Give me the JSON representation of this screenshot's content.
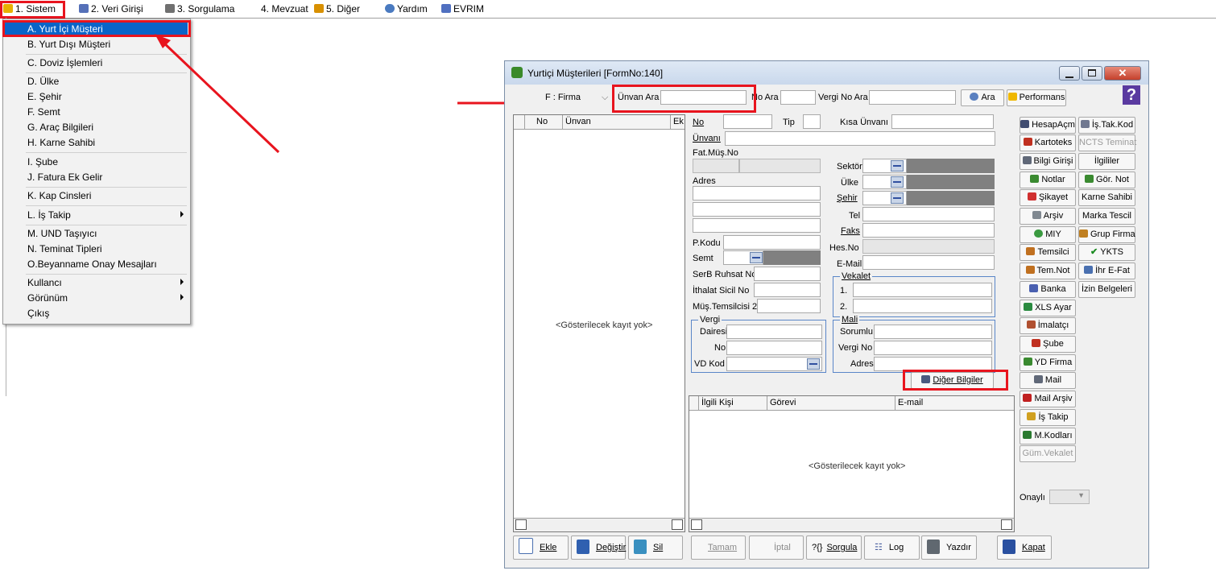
{
  "menubar": {
    "items": [
      {
        "label": "1. Sistem",
        "icon": "sistem-icon",
        "color": "#e8b000"
      },
      {
        "label": "2. Veri Girişi",
        "icon": "edit-icon",
        "color": "#5570b8"
      },
      {
        "label": "3. Sorgulama",
        "icon": "query-icon",
        "color": "#707070"
      },
      {
        "label": "4. Mevzuat",
        "icon": "",
        "color": ""
      },
      {
        "label": "5. Diğer",
        "icon": "other-icon",
        "color": "#d89000"
      },
      {
        "label": "Yardım",
        "icon": "help-icon",
        "color": "#4a7ac0"
      },
      {
        "label": "EVRIM",
        "icon": "evrim-icon",
        "color": "#5070c0"
      }
    ]
  },
  "sistem_menu": {
    "items": [
      "A. Yurt İçi Müşteri",
      "B. Yurt Dışı Müşteri",
      "C. Doviz İşlemleri",
      "D. Ülke",
      "E. Şehir",
      "F. Semt",
      "G. Araç Bilgileri",
      "H. Karne Sahibi",
      "I. Şube",
      "J. Fatura Ek Gelir",
      "K. Kap Cinsleri",
      "L. İş Takip",
      "M. UND Taşıyıcı",
      "N. Teminat Tipleri",
      "O.Beyanname Onay Mesajları",
      "Kullancı",
      "Görünüm",
      "Çıkış"
    ],
    "highlight_color": "#0a64c8"
  },
  "window": {
    "title": "Yurtiçi Müşterileri [FormNo:140]",
    "help_glyph": "?",
    "search": {
      "type_value": "F : Firma",
      "unvan_label": "Ünvan Ara",
      "no_label": "No Ara",
      "vergi_label": "Vergi No Ara",
      "ara_label": "Ara",
      "performans_label": "Performans"
    },
    "left_grid": {
      "headers": [
        "No",
        "Ünvan",
        "Ek"
      ],
      "empty_text": "<Gösterilecek kayıt yok>"
    },
    "form": {
      "no": "No",
      "tip": "Tip",
      "kisa_unvan": "Kısa Ünvanı",
      "unvani": "Ünvanı",
      "fat_mus_no": "Fat.Müş.No",
      "sektor": "Sektör",
      "adres": "Adres",
      "ulke": "Ülke",
      "sehir": "Şehir",
      "tel": "Tel",
      "faks": "Faks",
      "p_kodu": "P.Kodu",
      "hes_no": "Hes.No",
      "semt": "Semt",
      "e_mail": "E-Mail",
      "serb_ruhsat_no": "SerB Ruhsat No",
      "ithalat_sicil_no": "İthalat Sicil No",
      "mus_temsilcisi_2": "Müş.Temsilcisi 2",
      "vekalet": {
        "title": "Vekalet",
        "row1": "1.",
        "row2": "2."
      },
      "vergi": {
        "title": "Vergi",
        "dairesi": "Dairesi",
        "no": "No",
        "vd_kod": "VD Kod"
      },
      "mali": {
        "title": "Mali",
        "sorumlu": "Sorumlu",
        "vergi_no": "Vergi No",
        "adres": "Adres"
      },
      "diger_bilgiler": "Diğer Bilgiler"
    },
    "contact_grid": {
      "headers": [
        "İlgili Kişi",
        "Görevi",
        "E-mail"
      ],
      "empty_text": "<Gösterilecek kayıt yok>"
    },
    "right_buttons": {
      "col1": [
        "HesapAçm",
        "Kartoteks",
        "Bilgi Girişi",
        "Notlar",
        "Şikayet",
        "Arşiv",
        "MIY",
        "Temsilci",
        "Tem.Not",
        "Banka",
        "XLS Ayar",
        "İmalatçı",
        "Şube",
        "YD Firma",
        "Mail",
        "Mail Arşiv",
        "İş Takip",
        "M.Kodları",
        "Güm.Vekalet"
      ],
      "col2": [
        "İş.Tak.Kod",
        "NCTS Teminat",
        "İlgililer",
        "Gör. Not",
        "Karne Sahibi",
        "Marka Tescil",
        "Grup Firma",
        "YKTS",
        "İhr E-Fat",
        "İzin Belgeleri"
      ],
      "onayli_label": "Onaylı"
    },
    "bottom_buttons": [
      "Ekle",
      "Değiştir",
      "Sil",
      "Tamam",
      "İptal",
      "Sorgula",
      "Log",
      "Yazdır",
      "Kapat"
    ],
    "sorgula_prefix": "?{}"
  },
  "colors": {
    "annotation_red": "#e8141e",
    "group_border": "#5a86c8"
  }
}
